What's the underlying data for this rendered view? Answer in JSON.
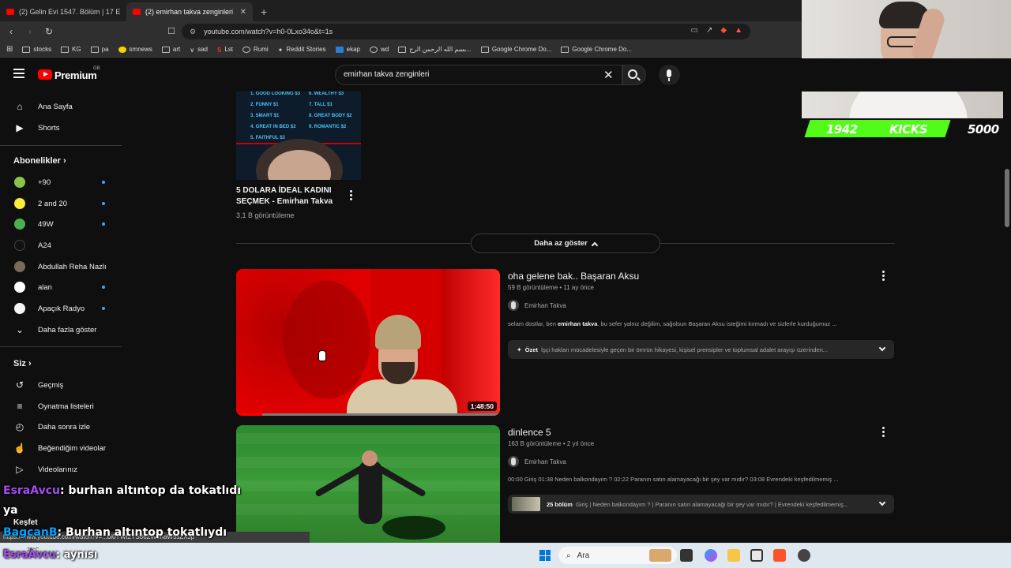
{
  "browser": {
    "tabs": [
      {
        "title": "(2) Gelin Evi 1547. Bölüm | 17 Eyl"
      },
      {
        "title": "(2) emirhan takva zenginleri - Yo",
        "close": "✕"
      }
    ],
    "new_tab": "+",
    "address": {
      "url": "youtube.com/watch?v=h0-0Lxo34o&t=1s"
    },
    "bookmarks": [
      "stocks",
      "KG",
      "pa",
      "smnews",
      "art",
      "sad",
      "Lst",
      "Rumi",
      "Reddit Stories",
      "ekap",
      "wd",
      "بسم الله الرحمن الرح...",
      "Google Chrome Do...",
      "Google Chrome Do..."
    ]
  },
  "stream_overlay": {
    "counter": "1942",
    "label": "KICKS",
    "goal": "5000"
  },
  "header": {
    "brand": "Premium",
    "country": "GB",
    "search_query": "emirhan takva zenginleri"
  },
  "sidebar": {
    "main": [
      {
        "label": "Ana Sayfa",
        "icon": "home-icon"
      },
      {
        "label": "Shorts",
        "icon": "shorts-icon"
      }
    ],
    "subscriptions_title": "Abonelikler",
    "subscriptions": [
      {
        "label": "+90",
        "color": "#8bc34a",
        "dot": true
      },
      {
        "label": "2 and 20",
        "color": "#ffeb3b",
        "dot": true
      },
      {
        "label": "49W",
        "color": "#4caf50",
        "dot": true
      },
      {
        "label": "A24",
        "color": "#111111",
        "dot": false
      },
      {
        "label": "Abdullah Reha Nazlı",
        "color": "#7a6a5a",
        "dot": false
      },
      {
        "label": "alan",
        "color": "#ffffff",
        "dot": true
      },
      {
        "label": "Apaçık Radyo",
        "color": "#f5f5f5",
        "dot": true
      }
    ],
    "show_more": "Daha fazla göster",
    "you_title": "Siz",
    "you_items": [
      {
        "label": "Geçmiş",
        "icon": "history-icon"
      },
      {
        "label": "Oynatma listeleri",
        "icon": "playlist-icon"
      },
      {
        "label": "Daha sonra izle",
        "icon": "watch-later-icon"
      },
      {
        "label": "Beğendiğim videolar",
        "icon": "like-icon"
      },
      {
        "label": "Videolarınız",
        "icon": "your-videos-icon"
      }
    ],
    "explore": "Keşfet"
  },
  "top_video": {
    "title": "5 DOLARA İDEAL KADINI SEÇMEK - Emirhan Takva",
    "views": "3,1 B görüntüleme",
    "thumb_lines_left": [
      "1. GOOD LOOKING $3",
      "2. FUNNY $1",
      "3. SMART $1",
      "4. GREAT IN BED $2",
      "5. FAITHFUL $3"
    ],
    "thumb_lines_right": [
      "6. WEALTHY $3",
      "7. TALL $1",
      "8. GREAT BODY $2",
      "9. ROMANTIC $2"
    ]
  },
  "show_less": "Daha az göster",
  "videos": [
    {
      "title": "oha gelene bak.. Başaran Aksu",
      "meta": "59 B görüntüleme • 11 ay önce",
      "channel": "Emirhan Takva",
      "desc_pre": "selam dostlar, ben ",
      "desc_bold": "emirhan takva",
      "desc_post": ". bu sefer yalnız değilim, sağolsun Başaran Aksu isteğimi kırmadı ve sizlerle kurduğumuz ...",
      "summary_label": "Özet",
      "summary_text": "İşçi hakları mücadelesiyle geçen bir ömrün hikayesi, kişisel prensipler ve toplumsal adalet arayışı üzerinden...",
      "duration": "1:48:50",
      "progress": 0.1
    },
    {
      "title": "dinlence 5",
      "meta": "163 B görüntüleme • 2 yıl önce",
      "channel": "Emirhan Takva",
      "desc": "00:00 Giriş 01:38 Neden balkondayım ? 02:22 Paranın satın alamayacağı bir şey var mıdır? 03:08 Evrendeki keşfedilmemiş ...",
      "episodes_count": "25 bölüm",
      "episodes_text": "Giriş | Neden balkondayım ? | Paranın satın alamayacağı bir şey var mıdır? | Evrendeki keşfedilmemiş..."
    }
  ],
  "chat": [
    {
      "user": "EsraAvcu",
      "message": ": burhan altıntop da tokatlıdı",
      "continued": "ya"
    },
    {
      "user": "BagcanB",
      "message": ": Burhan altıntop tokatlıydı"
    },
    {
      "user": "EsraAvcu",
      "message": ": aynısı"
    }
  ],
  "status_url": "https://www.youtube.com/watch?v=...bi0YWt2YS86ZW5naW5sZXJp",
  "taskbar": {
    "search_label": "Ara",
    "weather": "25°C"
  }
}
